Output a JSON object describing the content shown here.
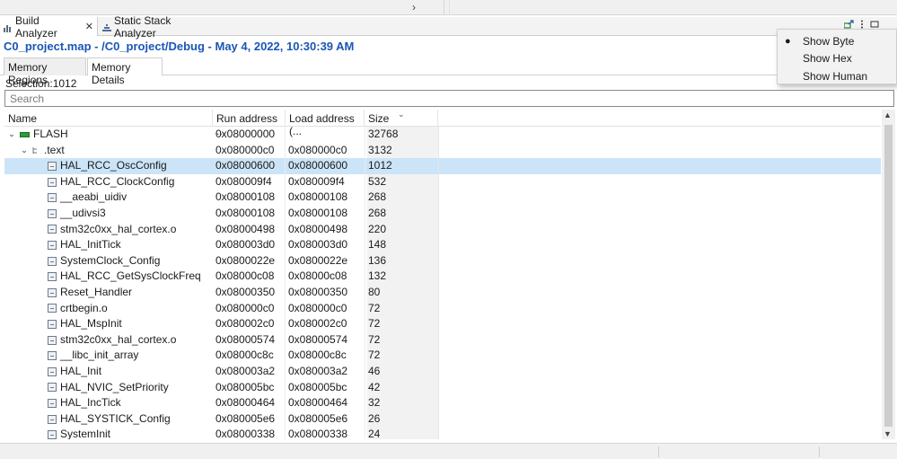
{
  "window": {
    "top_chevron": "›"
  },
  "view_tabs": [
    {
      "label": "Build Analyzer",
      "active": true,
      "close": "✕"
    },
    {
      "label": "Static Stack Analyzer",
      "active": false
    }
  ],
  "file": {
    "path": "C0_project.map - /C0_project/Debug - May 4, 2022, 10:30:39 AM"
  },
  "sub_tabs": [
    {
      "label": "Memory Regions",
      "active": false
    },
    {
      "label": "Memory Details",
      "active": true
    }
  ],
  "selection": "Selection:1012",
  "search": {
    "placeholder": "Search",
    "value": ""
  },
  "table": {
    "columns": [
      "Name",
      "Run address ...",
      "Load address (...",
      "Size"
    ],
    "sort_indicator": "⌄",
    "rows": [
      {
        "name": "FLASH",
        "run": "0x08000000",
        "load": "",
        "size": "32768",
        "level": 0,
        "type": "region",
        "twisty": "⌄"
      },
      {
        "name": ".text",
        "run": "0x080000c0",
        "load": "0x080000c0",
        "size": "3132",
        "level": 1,
        "type": "section",
        "twisty": "⌄"
      },
      {
        "name": "HAL_RCC_OscConfig",
        "run": "0x08000600",
        "load": "0x08000600",
        "size": "1012",
        "level": 2,
        "type": "symbol",
        "selected": true
      },
      {
        "name": "HAL_RCC_ClockConfig",
        "run": "0x080009f4",
        "load": "0x080009f4",
        "size": "532",
        "level": 2,
        "type": "symbol"
      },
      {
        "name": "__aeabi_uidiv",
        "run": "0x08000108",
        "load": "0x08000108",
        "size": "268",
        "level": 2,
        "type": "symbol"
      },
      {
        "name": "__udivsi3",
        "run": "0x08000108",
        "load": "0x08000108",
        "size": "268",
        "level": 2,
        "type": "symbol"
      },
      {
        "name": "stm32c0xx_hal_cortex.o",
        "run": "0x08000498",
        "load": "0x08000498",
        "size": "220",
        "level": 2,
        "type": "symbol"
      },
      {
        "name": "HAL_InitTick",
        "run": "0x080003d0",
        "load": "0x080003d0",
        "size": "148",
        "level": 2,
        "type": "symbol"
      },
      {
        "name": "SystemClock_Config",
        "run": "0x0800022e",
        "load": "0x0800022e",
        "size": "136",
        "level": 2,
        "type": "symbol"
      },
      {
        "name": "HAL_RCC_GetSysClockFreq",
        "run": "0x08000c08",
        "load": "0x08000c08",
        "size": "132",
        "level": 2,
        "type": "symbol"
      },
      {
        "name": "Reset_Handler",
        "run": "0x08000350",
        "load": "0x08000350",
        "size": "80",
        "level": 2,
        "type": "symbol"
      },
      {
        "name": "crtbegin.o",
        "run": "0x080000c0",
        "load": "0x080000c0",
        "size": "72",
        "level": 2,
        "type": "symbol"
      },
      {
        "name": "HAL_MspInit",
        "run": "0x080002c0",
        "load": "0x080002c0",
        "size": "72",
        "level": 2,
        "type": "symbol"
      },
      {
        "name": "stm32c0xx_hal_cortex.o",
        "run": "0x08000574",
        "load": "0x08000574",
        "size": "72",
        "level": 2,
        "type": "symbol"
      },
      {
        "name": "__libc_init_array",
        "run": "0x08000c8c",
        "load": "0x08000c8c",
        "size": "72",
        "level": 2,
        "type": "symbol"
      },
      {
        "name": "HAL_Init",
        "run": "0x080003a2",
        "load": "0x080003a2",
        "size": "46",
        "level": 2,
        "type": "symbol"
      },
      {
        "name": "HAL_NVIC_SetPriority",
        "run": "0x080005bc",
        "load": "0x080005bc",
        "size": "42",
        "level": 2,
        "type": "symbol"
      },
      {
        "name": "HAL_IncTick",
        "run": "0x08000464",
        "load": "0x08000464",
        "size": "32",
        "level": 2,
        "type": "symbol"
      },
      {
        "name": "HAL_SYSTICK_Config",
        "run": "0x080005e6",
        "load": "0x080005e6",
        "size": "26",
        "level": 2,
        "type": "symbol"
      },
      {
        "name": "SystemInit",
        "run": "0x08000338",
        "load": "0x08000338",
        "size": "24",
        "level": 2,
        "type": "symbol"
      }
    ]
  },
  "menu": {
    "items": [
      {
        "label": "Show Byte",
        "checked": true
      },
      {
        "label": "Show Hex",
        "checked": false
      },
      {
        "label": "Show Human",
        "checked": false
      }
    ],
    "check_glyph": "●"
  },
  "view_toolbar": {
    "icons": [
      "export-icon",
      "kebab-menu-icon",
      "minimize-icon"
    ]
  },
  "scrollbar": {
    "up": "▲",
    "down": "▼"
  },
  "colors": {
    "title_blue": "#1a56b6",
    "selected_row": "#cce4f7",
    "flash_green": "#2f9a3a"
  }
}
